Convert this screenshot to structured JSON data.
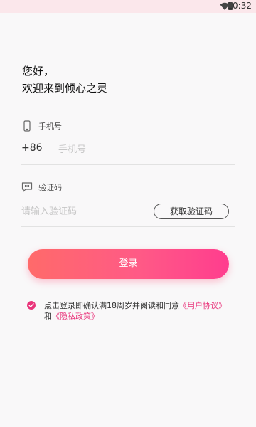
{
  "status_bar": {
    "time": "10:32",
    "icons": [
      "wifi-icon",
      "battery-icon"
    ]
  },
  "greeting": {
    "line1": "您好，",
    "line2": "欢迎来到倾心之灵"
  },
  "phone": {
    "label": "手机号",
    "icon": "phone-icon",
    "country_code": "+86",
    "placeholder": "手机号",
    "value": ""
  },
  "code": {
    "label": "验证码",
    "icon": "message-icon",
    "placeholder": "请输入验证码",
    "value": "",
    "get_code_label": "获取验证码"
  },
  "login": {
    "label": "登录"
  },
  "agreement": {
    "checked": true,
    "text_prefix": "点击登录即确认满18周岁并阅读和同意",
    "user_agreement": "《用户协议》",
    "conjunction": "和",
    "privacy_policy": "《隐私政策》"
  },
  "colors": {
    "accent": "#e9337a",
    "button_gradient_start": "#ff6a6a",
    "button_gradient_end": "#ff3d8e",
    "status_bar_bg": "#fbe7eb",
    "page_bg": "#f9f8f9"
  }
}
